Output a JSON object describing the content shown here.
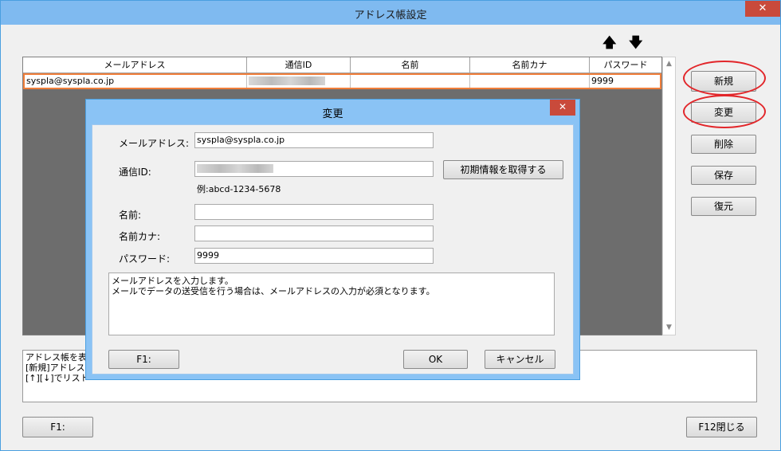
{
  "window": {
    "title": "アドレス帳設定",
    "close": "✕"
  },
  "arrows": {
    "up": "🡅",
    "down": "🡇"
  },
  "grid": {
    "columns": [
      "メールアドレス",
      "通信ID",
      "名前",
      "名前カナ",
      "パスワード"
    ],
    "row": {
      "email": "syspla@syspla.co.jp",
      "comm_id": "",
      "name": "",
      "kana": "",
      "password": "9999"
    }
  },
  "buttons": {
    "new": "新規",
    "change": "変更",
    "delete": "削除",
    "save": "保存",
    "restore": "復元",
    "f1": "F1:",
    "f12": "F12閉じる"
  },
  "message": {
    "line1": "アドレス帳を表示",
    "line2": "[新規]アドレス帳",
    "line3": "[↑][↓]でリスト"
  },
  "dialog": {
    "title": "変更",
    "close": "✕",
    "labels": {
      "email": "メールアドレス:",
      "comm_id": "通信ID:",
      "name": "名前:",
      "kana": "名前カナ:",
      "password": "パスワード:"
    },
    "values": {
      "email": "syspla@syspla.co.jp",
      "comm_id": "",
      "name": "",
      "kana": "",
      "password": "9999"
    },
    "example": "例:abcd-1234-5678",
    "fetch_button": "初期情報を取得する",
    "description": {
      "line1": "メールアドレスを入力します。",
      "line2": "メールでデータの送受信を行う場合は、メールアドレスの入力が必須となります。"
    },
    "f1": "F1:",
    "ok": "OK",
    "cancel": "キャンセル"
  }
}
